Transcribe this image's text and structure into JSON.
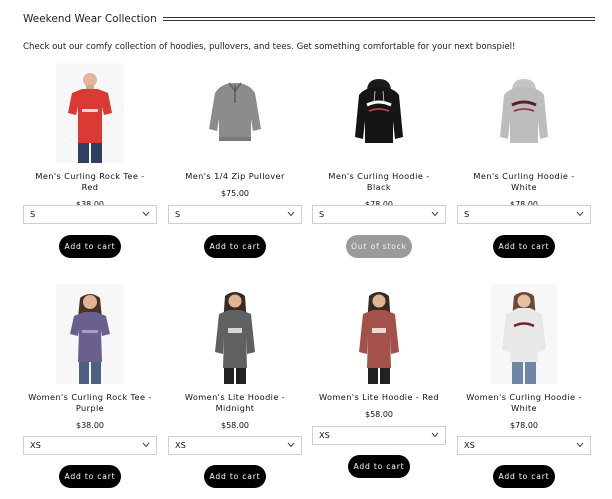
{
  "header": {
    "title": "Weekend Wear Collection"
  },
  "intro": "Check out our comfy collection of hoodies, pullovers, and tees. Get something comfortable for your next bonspiel!",
  "products": [
    {
      "name": "Men's Curling Rock Tee - Red",
      "price": "$38.00",
      "size": "S",
      "button": "Add to cart",
      "available": true,
      "image": "mens-red-tee-photo",
      "color": "#d93a34"
    },
    {
      "name": "Men's 1/4 Zip Pullover",
      "price": "$75.00",
      "size": "S",
      "button": "Add to cart",
      "available": true,
      "image": "quarter-zip-pullover-photo",
      "color": "#8c8c8c"
    },
    {
      "name": "Men's Curling Hoodie - Black",
      "price": "$78.00",
      "size": "S",
      "button": "Out of stock",
      "available": false,
      "image": "black-hoodie-photo",
      "color": "#151515"
    },
    {
      "name": "Men's Curling Hoodie - White",
      "price": "$78.00",
      "size": "S",
      "button": "Add to cart",
      "available": true,
      "image": "white-hoodie-photo",
      "color": "#bdbdbd"
    },
    {
      "name": "Women's Curling Rock Tee - Purple",
      "price": "$38.00",
      "size": "XS",
      "button": "Add to cart",
      "available": true,
      "image": "womens-purple-tee-photo",
      "color": "#6a5f8f"
    },
    {
      "name": "Women's Lite Hoodie - Midnight",
      "price": "$58.00",
      "size": "XS",
      "button": "Add to cart",
      "available": true,
      "image": "midnight-lite-hoodie-photo",
      "color": "#5f6062"
    },
    {
      "name": "Women's Lite Hoodie - Red",
      "price": "$58.00",
      "size": "XS",
      "button": "Add to cart",
      "available": true,
      "image": "red-lite-hoodie-photo",
      "color": "#a4504b"
    },
    {
      "name": "Women's Curling Hoodie - White",
      "price": "$78.00",
      "size": "XS",
      "button": "Add to cart",
      "available": true,
      "image": "womens-white-hoodie-photo",
      "color": "#e8e8e8"
    }
  ]
}
